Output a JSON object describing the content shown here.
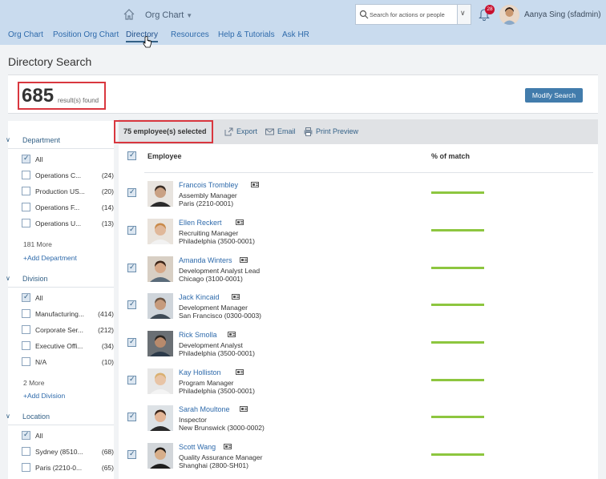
{
  "header": {
    "app_title": "Org Chart",
    "search_placeholder": "Search for actions or people",
    "notification_count": "28",
    "user_name": "Aanya Sing (sfadmin)"
  },
  "topnav": [
    "Org Chart",
    "Position Org Chart",
    "Directory",
    "Resources",
    "Help & Tutorials",
    "Ask HR"
  ],
  "page_title": "Directory Search",
  "results": {
    "count": "685",
    "label": "result(s) found",
    "modify_label": "Modify Search"
  },
  "toolbar": {
    "selected": "75 employee(s) selected",
    "export": "Export",
    "email": "Email",
    "print": "Print Preview"
  },
  "table": {
    "col_employee": "Employee",
    "col_match": "% of match"
  },
  "sidebar": {
    "department": {
      "title": "Department",
      "items": [
        {
          "label": "All",
          "count": ""
        },
        {
          "label": "Operations C...",
          "count": "(24)"
        },
        {
          "label": "Production US...",
          "count": "(20)"
        },
        {
          "label": "Operations F...",
          "count": "(14)"
        },
        {
          "label": "Operations U...",
          "count": "(13)"
        }
      ],
      "more": "181 More",
      "add": "+Add Department"
    },
    "division": {
      "title": "Division",
      "items": [
        {
          "label": "All",
          "count": ""
        },
        {
          "label": "Manufacturing...",
          "count": "(414)"
        },
        {
          "label": "Corporate Ser...",
          "count": "(212)"
        },
        {
          "label": "Executive Offi...",
          "count": "(34)"
        },
        {
          "label": "N/A",
          "count": "(10)"
        }
      ],
      "more": "2 More",
      "add": "+Add Division"
    },
    "location": {
      "title": "Location",
      "items": [
        {
          "label": "All",
          "count": ""
        },
        {
          "label": "Sydney (8510...",
          "count": "(68)"
        },
        {
          "label": "Paris (2210-0...",
          "count": "(65)"
        }
      ]
    }
  },
  "employees": [
    {
      "name": "Francois Trombley",
      "title": "Assembly Manager",
      "location": "Paris (2210-0001)"
    },
    {
      "name": "Ellen Reckert",
      "title": "Recruiting Manager",
      "location": "Philadelphia (3500-0001)"
    },
    {
      "name": "Amanda Winters",
      "title": "Development Analyst Lead",
      "location": "Chicago (3100-0001)"
    },
    {
      "name": "Jack Kincaid",
      "title": "Development Manager",
      "location": "San Francisco (0300-0003)"
    },
    {
      "name": "Rick Smolla",
      "title": "Development Analyst",
      "location": "Philadelphia (3500-0001)"
    },
    {
      "name": "Kay Holliston",
      "title": "Program Manager",
      "location": "Philadelphia (3500-0001)"
    },
    {
      "name": "Sarah Moultone",
      "title": "Inspector",
      "location": "New Brunswick (3000-0002)"
    },
    {
      "name": "Scott Wang",
      "title": "Quality Assurance Manager",
      "location": "Shanghai (2800-SH01)"
    }
  ],
  "colors": {
    "accent": "#346187",
    "button": "#427cac",
    "highlight": "#d9373f",
    "match_bar": "#8dc63f"
  }
}
